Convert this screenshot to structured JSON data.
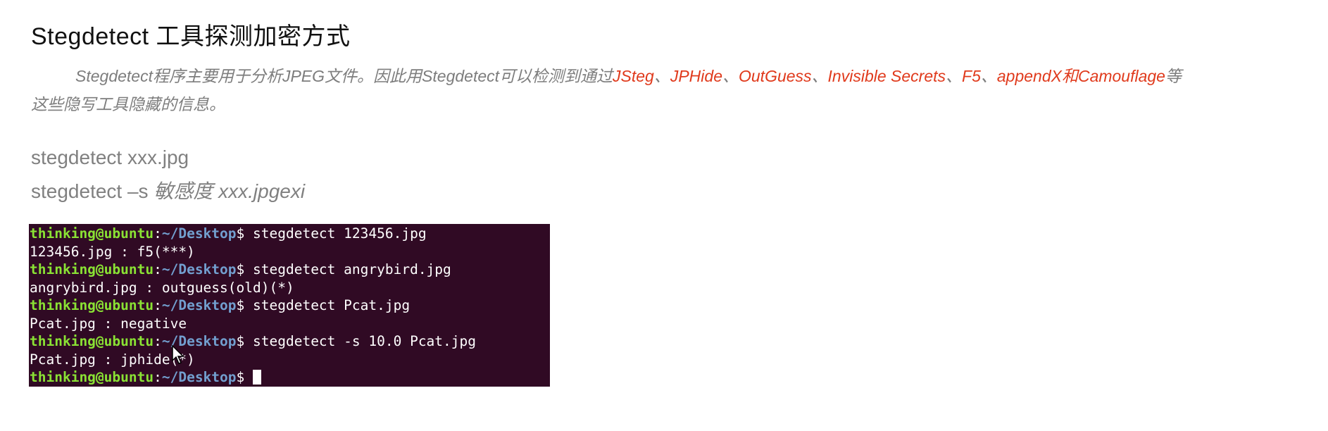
{
  "heading": "Stegdetect 工具探测加密方式",
  "intro": {
    "line1_prefix": "Stegdetect程序主要用于分析JPEG文件。因此用Stegdetect可以检测到通过",
    "tools": [
      "JSteg",
      "JPHide",
      "OutGuess",
      "Invisible Secrets",
      "F5",
      "appendX"
    ],
    "list_separator": "、",
    "conjunction": "和",
    "last_tool": "Camouflage",
    "line1_suffix": "等",
    "line2": "这些隐写工具隐藏的信息。"
  },
  "commands": {
    "cmd1": "stegdetect xxx.jpg",
    "cmd2_prefix": "stegdetect –s ",
    "cmd2_param": "敏感度 xxx.jpgexi"
  },
  "terminal": {
    "user": "thinking@ubuntu",
    "colon": ":",
    "path": "~/Desktop",
    "dollar": "$ ",
    "lines": [
      {
        "type": "prompt",
        "text": "stegdetect 123456.jpg"
      },
      {
        "type": "output",
        "text": "123456.jpg : f5(***)"
      },
      {
        "type": "prompt",
        "text": "stegdetect angrybird.jpg"
      },
      {
        "type": "output",
        "text": "angrybird.jpg : outguess(old)(*)"
      },
      {
        "type": "prompt",
        "text": "stegdetect Pcat.jpg"
      },
      {
        "type": "output",
        "text": "Pcat.jpg : negative"
      },
      {
        "type": "prompt",
        "text": "stegdetect -s 10.0 Pcat.jpg"
      },
      {
        "type": "output",
        "text": "Pcat.jpg : jphide(*)"
      },
      {
        "type": "prompt",
        "text": "",
        "cursor": true
      }
    ]
  },
  "colors": {
    "tool_highlight": "#e03a1c",
    "terminal_bg": "#300a24",
    "prompt_user": "#8ae234",
    "prompt_path": "#729fcf"
  },
  "icons": {
    "pointer": "mouse-pointer-icon"
  }
}
